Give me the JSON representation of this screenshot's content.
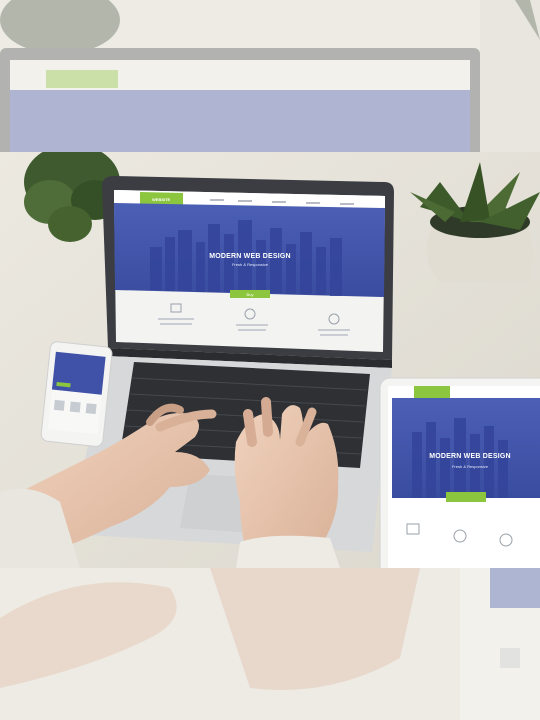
{
  "screen_site": {
    "logo_label": "WEBSITE",
    "hero_title": "MODERN WEB DESIGN",
    "hero_subtitle": "Fresh & Responsive",
    "hero_button": "Buy"
  },
  "colors": {
    "site_blue": "#3c4fa6",
    "site_green": "#8cc63f",
    "desk": "#e8e5dc",
    "laptop_body": "#d9dadb"
  }
}
